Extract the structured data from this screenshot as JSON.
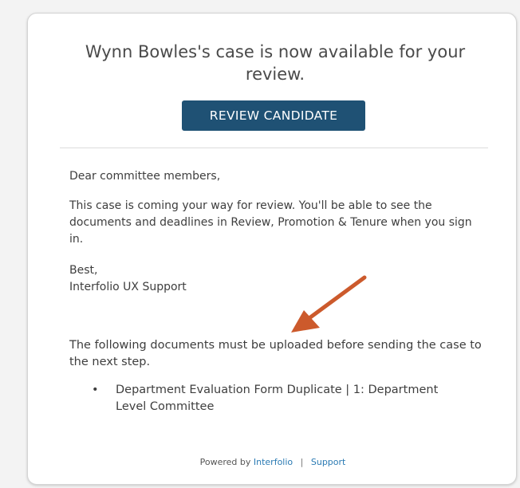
{
  "email": {
    "heading": "Wynn Bowles's case is now available for your review.",
    "review_button_label": "REVIEW CANDIDATE",
    "salutation": "Dear committee members,",
    "intro": "This case is coming your way for review. You'll be able to see the documents and deadlines in Review, Promotion & Tenure when you sign in.",
    "signoff_line1": "Best,",
    "signoff_line2": "Interfolio UX Support",
    "required_docs_intro": "The following documents must be uploaded before sending the case to the next step.",
    "required_documents": [
      "Department Evaluation Form Duplicate | 1: Department Level Committee"
    ],
    "footer": {
      "powered_by": "Powered by",
      "interfolio_link": "Interfolio",
      "separator": "|",
      "support_link": "Support"
    }
  },
  "annotation": {
    "arrow_color": "#cc5a2c"
  },
  "colors": {
    "button_bg": "#1f5174",
    "link": "#2a7ab3"
  }
}
